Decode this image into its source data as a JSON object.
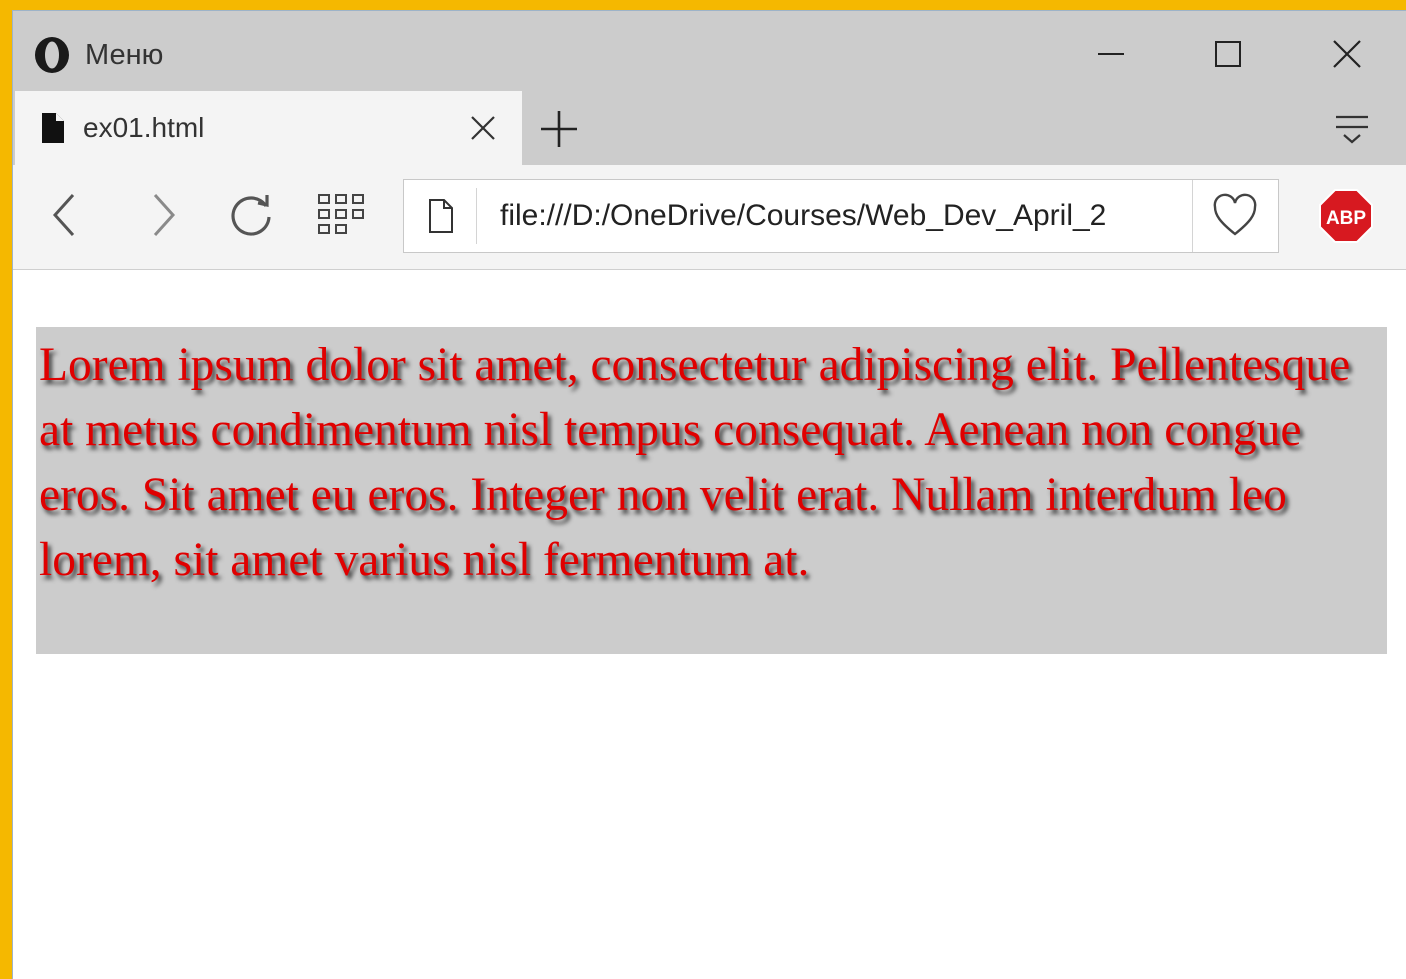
{
  "titlebar": {
    "menu_label": "Меню",
    "icons": [
      "opera-logo-icon",
      "minimize-icon",
      "maximize-icon",
      "close-icon"
    ]
  },
  "tabs": [
    {
      "label": "ex01.html",
      "icon": "document-icon",
      "close_icon": "close-icon",
      "active": true
    }
  ],
  "tabstrip": {
    "new_tab_icon": "plus-icon",
    "tab_menu_icon": "tab-menu-icon"
  },
  "toolbar": {
    "icons": [
      "back-icon",
      "forward-icon",
      "reload-icon",
      "speed-dial-icon",
      "page-icon",
      "heart-icon",
      "adblock-plus-icon"
    ],
    "adblock_label": "ABP"
  },
  "address": {
    "url": "file:///D:/OneDrive/Courses/Web_Dev_April_2"
  },
  "page": {
    "paragraph": "Lorem ipsum dolor sit amet, consectetur adipiscing elit. Pellentesque at metus condimentum nisl tempus consequat. Aenean non congue eros. Sit amet eu eros. Integer non velit erat. Nullam interdum leo lorem, sit amet varius nisl fermentum at."
  },
  "colors": {
    "frame_accent": "#f5b800",
    "chrome": "#cccccc",
    "toolbar": "#f4f4f4",
    "text_red": "#e00000",
    "paragraph_bg": "#cccccc",
    "abp_red": "#d71920"
  }
}
